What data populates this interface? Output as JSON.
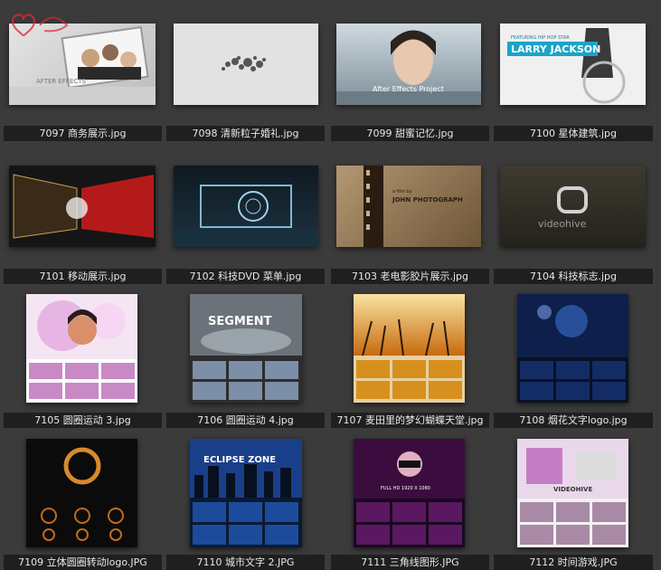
{
  "window": {
    "title": ""
  },
  "items": [
    {
      "label": "7097 商务展示.jpg"
    },
    {
      "label": "7098 清新粒子婚礼.jpg"
    },
    {
      "label": "7099 甜蜜记忆.jpg"
    },
    {
      "label": "7100 星体建筑.jpg"
    },
    {
      "label": "7101 移动展示.jpg"
    },
    {
      "label": "7102 科技DVD 菜单.jpg"
    },
    {
      "label": "7103 老电影胶片展示.jpg"
    },
    {
      "label": "7104 科技标志.jpg"
    },
    {
      "label": "7105 圆圈运动 3.jpg"
    },
    {
      "label": "7106 圆圈运动 4.jpg"
    },
    {
      "label": "7107 麦田里的梦幻蝴蝶天堂.jpg"
    },
    {
      "label": "7108 烟花文字logo.jpg"
    },
    {
      "label": "7109 立体圆圈转动logo.JPG"
    },
    {
      "label": "7110 城市文字 2.JPG"
    },
    {
      "label": "7111 三角线图形.JPG"
    },
    {
      "label": "7112 时间游戏.JPG"
    }
  ],
  "thumb_text": {
    "t7097": "AFTER EFFECTS",
    "t7099": "After Effects Project",
    "t7100a": "LARRY JACKSON",
    "t7100b": "FEATURING HIP HOP STAR",
    "t7103a": "a film by",
    "t7103b": "JOHN PHOTOGRAPH",
    "t7104": "videohive",
    "t7106": "SEGMENT",
    "t7110": "ECLIPSE ZONE",
    "t7111": "FULL HD 1920 X 1080",
    "t7112": "VIDEOHIVE"
  },
  "colors": {
    "background": "#3b3b3b",
    "label_bg": "#1f1f1f",
    "label_text": "#e8e8e8"
  }
}
